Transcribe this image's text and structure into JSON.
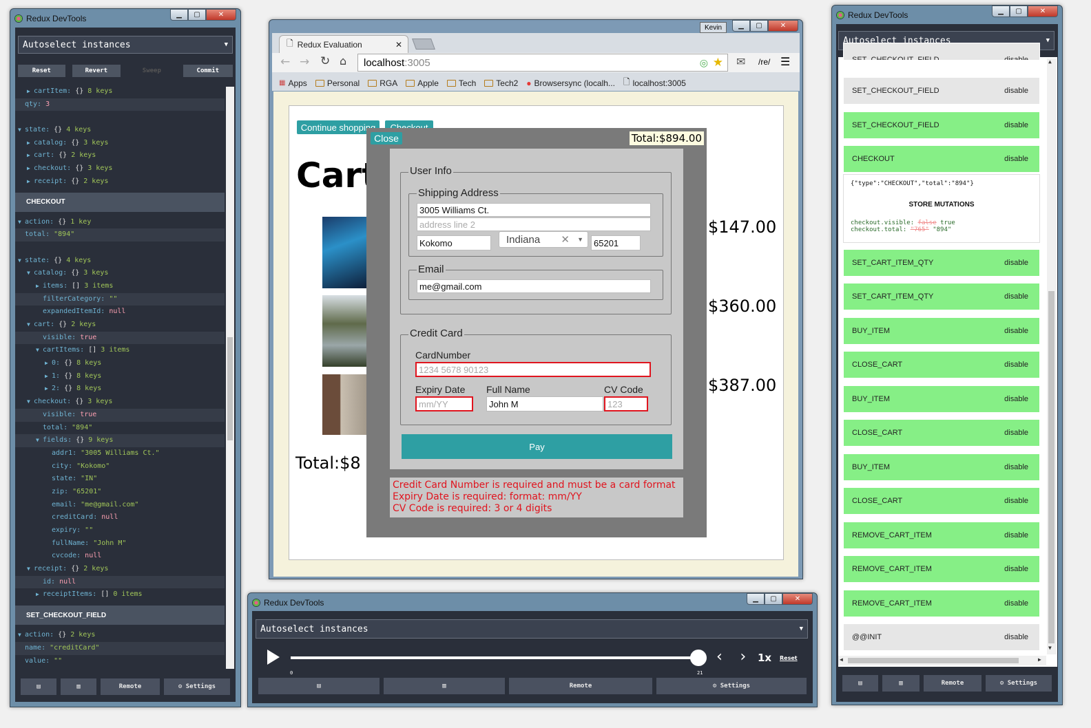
{
  "left": {
    "title": "Redux DevTools",
    "instance": "Autoselect instances",
    "buttons": [
      "Reset",
      "Revert",
      "Sweep",
      "Commit"
    ],
    "tree": [
      {
        "ind": 2,
        "arrow": "▶",
        "k": "cartItem:",
        "t": " {}",
        "v": "  8 keys"
      },
      {
        "ind": 1,
        "arrow": "",
        "k": "qty:",
        "n": " 3",
        "hl": true
      },
      {
        "gap": true
      },
      {
        "ind": 1,
        "arrow": "▼",
        "k": "state:",
        "t": " {}",
        "v": "  4 keys"
      },
      {
        "ind": 2,
        "arrow": "▶",
        "k": "catalog:",
        "t": " {}",
        "v": "  3 keys"
      },
      {
        "ind": 2,
        "arrow": "▶",
        "k": "cart:",
        "t": " {}",
        "v": "  2 keys"
      },
      {
        "ind": 2,
        "arrow": "▶",
        "k": "checkout:",
        "t": " {}",
        "v": "  3 keys"
      },
      {
        "ind": 2,
        "arrow": "▶",
        "k": "receipt:",
        "t": " {}",
        "v": "  2 keys"
      }
    ],
    "action_checkout": "CHECKOUT",
    "tree2": [
      {
        "ind": 1,
        "arrow": "▼",
        "k": "action:",
        "t": " {}",
        "v": "  1 key"
      },
      {
        "ind": 1,
        "arrow": "",
        "k": "total:",
        "s": " \"894\"",
        "hl": true
      },
      {
        "gap": true
      },
      {
        "ind": 1,
        "arrow": "▼",
        "k": "state:",
        "t": " {}",
        "v": "  4 keys"
      },
      {
        "ind": 2,
        "arrow": "▼",
        "k": "catalog:",
        "t": " {}",
        "v": "  3 keys"
      },
      {
        "ind": 3,
        "arrow": "▶",
        "k": "items:",
        "t": " []",
        "v": "  3 items"
      },
      {
        "ind": 3,
        "arrow": "",
        "k": "filterCategory:",
        "s": " \"\"",
        "hl": true
      },
      {
        "ind": 3,
        "arrow": "",
        "k": "expandedItemId:",
        "n": " null"
      },
      {
        "ind": 2,
        "arrow": "▼",
        "k": "cart:",
        "t": " {}",
        "v": "  2 keys"
      },
      {
        "ind": 3,
        "arrow": "",
        "k": "visible:",
        "n": " true",
        "hl": true
      },
      {
        "ind": 3,
        "arrow": "▼",
        "k": "cartItems:",
        "t": " []",
        "v": "  3 items"
      },
      {
        "ind": 4,
        "arrow": "▶",
        "k": "0:",
        "t": " {}",
        "v": "  8 keys"
      },
      {
        "ind": 4,
        "arrow": "▶",
        "k": "1:",
        "t": " {}",
        "v": "  8 keys"
      },
      {
        "ind": 4,
        "arrow": "▶",
        "k": "2:",
        "t": " {}",
        "v": "  8 keys"
      },
      {
        "ind": 2,
        "arrow": "▼",
        "k": "checkout:",
        "t": " {}",
        "v": "  3 keys"
      },
      {
        "ind": 3,
        "arrow": "",
        "k": "visible:",
        "n": " true",
        "hl": true
      },
      {
        "ind": 3,
        "arrow": "",
        "k": "total:",
        "s": " \"894\""
      },
      {
        "ind": 3,
        "arrow": "▼",
        "k": "fields:",
        "t": " {}",
        "v": "  9 keys",
        "hl": true
      },
      {
        "ind": 4,
        "arrow": "",
        "k": "addr1:",
        "s": " \"3005 Williams Ct.\""
      },
      {
        "ind": 4,
        "arrow": "",
        "k": "city:",
        "s": " \"Kokomo\""
      },
      {
        "ind": 4,
        "arrow": "",
        "k": "state:",
        "s": " \"IN\""
      },
      {
        "ind": 4,
        "arrow": "",
        "k": "zip:",
        "s": " \"65201\""
      },
      {
        "ind": 4,
        "arrow": "",
        "k": "email:",
        "s": " \"me@gmail.com\""
      },
      {
        "ind": 4,
        "arrow": "",
        "k": "creditCard:",
        "n": " null"
      },
      {
        "ind": 4,
        "arrow": "",
        "k": "expiry:",
        "s": " \"\""
      },
      {
        "ind": 4,
        "arrow": "",
        "k": "fullName:",
        "s": " \"John M\""
      },
      {
        "ind": 4,
        "arrow": "",
        "k": "cvcode:",
        "n": " null"
      },
      {
        "ind": 2,
        "arrow": "▼",
        "k": "receipt:",
        "t": " {}",
        "v": "  2 keys"
      },
      {
        "ind": 3,
        "arrow": "",
        "k": "id:",
        "n": " null",
        "hl": true
      },
      {
        "ind": 3,
        "arrow": "▶",
        "k": "receiptItems:",
        "t": " []",
        "v": "  0 items"
      }
    ],
    "action_set": "SET_CHECKOUT_FIELD",
    "tree3": [
      {
        "ind": 1,
        "arrow": "▼",
        "k": "action:",
        "t": " {}",
        "v": "  2 keys"
      },
      {
        "ind": 1,
        "arrow": "",
        "k": "name:",
        "s": " \"creditCard\"",
        "hl": true
      },
      {
        "ind": 1,
        "arrow": "",
        "k": "value:",
        "s": " \"\""
      }
    ],
    "footer": [
      "▤",
      "▥",
      "Remote",
      "⚙ Settings"
    ]
  },
  "browser": {
    "tab_title": "Redux Evaluation",
    "user": "Kevin",
    "url_host": "localhost",
    "url_port": ":3005",
    "bookmarks": [
      "Apps",
      "Personal",
      "RGA",
      "Apple",
      "Tech",
      "Tech2",
      "Browsersync (localh...",
      "localhost:3005"
    ],
    "ext": "/re/",
    "continue": "Continue shopping",
    "checkout": "Checkout",
    "cart_title": "Cart",
    "prices": [
      "$147.00",
      "$360.00",
      "$387.00"
    ],
    "total_partial": "Total:$8",
    "modal": {
      "close": "Close",
      "total": "Total:$894.00",
      "user_info": "User Info",
      "shipping": "Shipping Address",
      "addr1": "3005 Williams Ct.",
      "addr2_ph": "address line 2",
      "city": "Kokomo",
      "state": "Indiana",
      "zip": "65201",
      "email_label": "Email",
      "email": "me@gmail.com",
      "cc_legend": "Credit Card",
      "card_label": "CardNumber",
      "card_ph": "1234 5678 90123",
      "expiry_label": "Expiry Date",
      "expiry_ph": "mm/YY",
      "name_label": "Full Name",
      "name": "John M",
      "cv_label": "CV Code",
      "cv_ph": "123",
      "pay": "Pay",
      "errors": [
        "Credit Card Number is required and must be a card format",
        "Expiry Date is required: format: mm/YY",
        "CV Code is required: 3 or 4 digits"
      ]
    }
  },
  "bottom": {
    "title": "Redux DevTools",
    "instance": "Autoselect instances",
    "speed": "1x",
    "reset": "Reset",
    "tick_start": "0",
    "tick_end": "21",
    "slider_fraction": 1.0,
    "footer": [
      "▤",
      "▥",
      "Remote",
      "⚙ Settings"
    ]
  },
  "right": {
    "title": "Redux DevTools",
    "instance": "Autoselect instances",
    "top_cut": "SET_CHECKOUT_FIELD",
    "disable": "disable",
    "actions": [
      {
        "name": "SET_CHECKOUT_FIELD",
        "grey": true
      },
      {
        "name": "SET_CHECKOUT_FIELD"
      },
      {
        "name": "CHECKOUT"
      },
      {
        "name": "SET_CART_ITEM_QTY"
      },
      {
        "name": "SET_CART_ITEM_QTY"
      },
      {
        "name": "BUY_ITEM"
      },
      {
        "name": "CLOSE_CART"
      },
      {
        "name": "BUY_ITEM"
      },
      {
        "name": "CLOSE_CART"
      },
      {
        "name": "BUY_ITEM"
      },
      {
        "name": "CLOSE_CART"
      },
      {
        "name": "REMOVE_CART_ITEM"
      },
      {
        "name": "REMOVE_CART_ITEM"
      },
      {
        "name": "REMOVE_CART_ITEM"
      },
      {
        "name": "@@INIT",
        "grey": true
      }
    ],
    "detail_json": "{\"type\":\"CHECKOUT\",\"total\":\"894\"}",
    "mutations_title": "STORE MUTATIONS",
    "mut1_key": "checkout.visible:",
    "mut1_old": "false",
    "mut1_new": "true",
    "mut2_key": "checkout.total:",
    "mut2_old": "\"765\"",
    "mut2_new": "\"894\"",
    "footer": [
      "▤",
      "▥",
      "Remote",
      "⚙ Settings"
    ]
  },
  "colors": {
    "devtools_bg": "#2a2f3a",
    "action_green": "#86ef86",
    "teal": "#2e9fa3",
    "error_red": "#e0141e"
  }
}
